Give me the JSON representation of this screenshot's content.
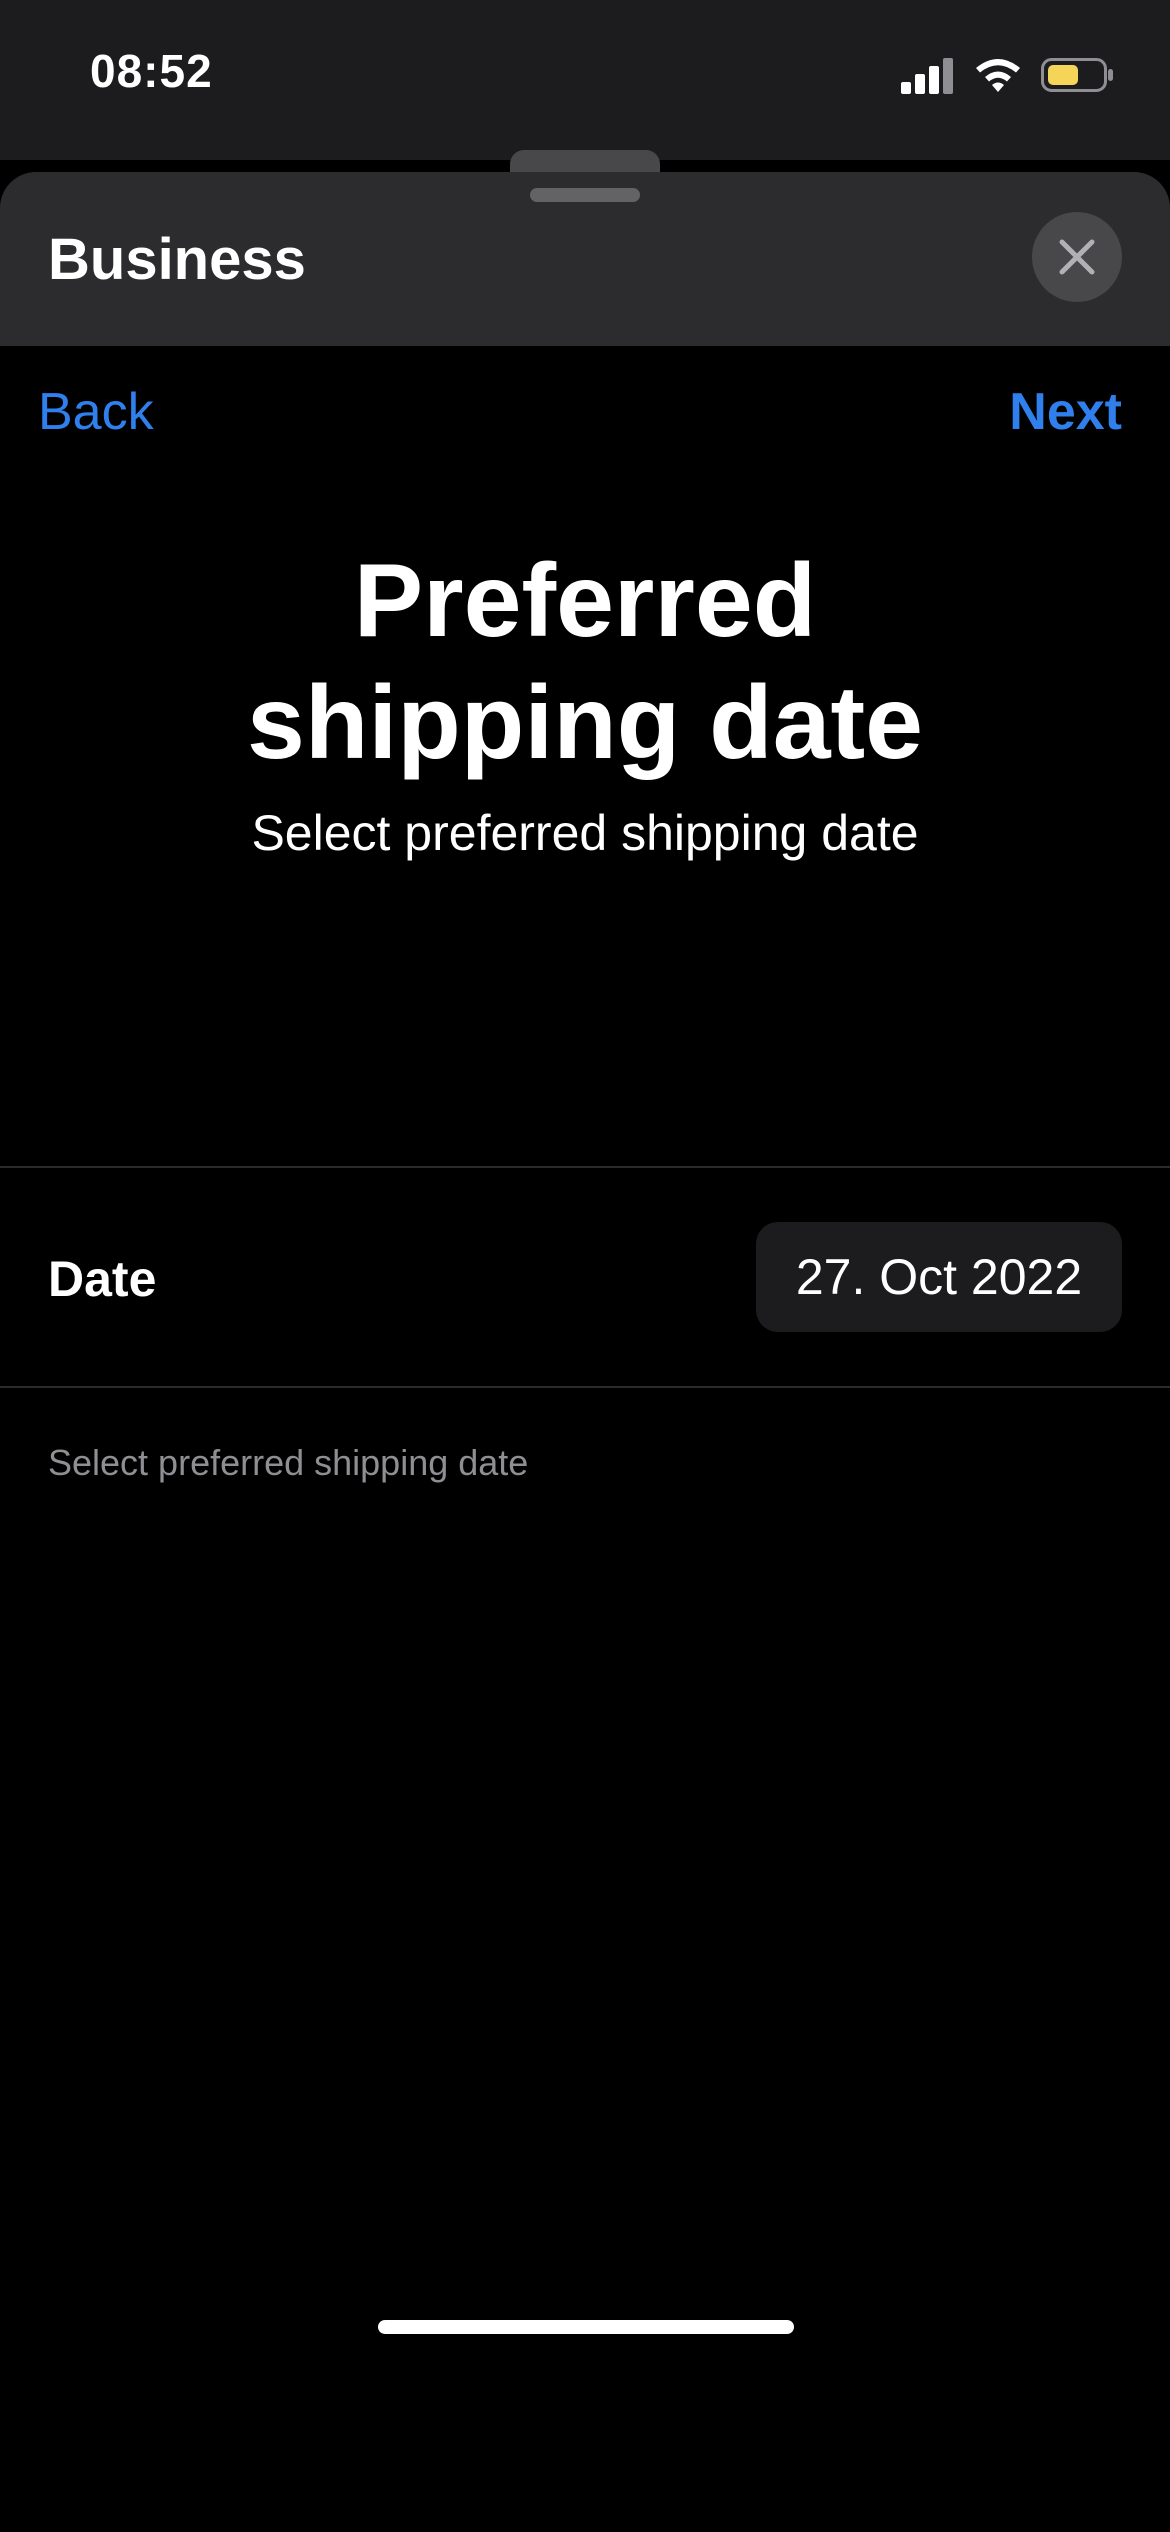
{
  "status_bar": {
    "time": "08:52",
    "icons": [
      "cellular-signal-icon",
      "wifi-icon",
      "battery-icon"
    ],
    "battery_color": "#f4d55a"
  },
  "sheet": {
    "title": "Business",
    "close_icon": "close-icon"
  },
  "nav": {
    "back_label": "Back",
    "next_label": "Next",
    "accent_color": "#2f80ed"
  },
  "page": {
    "title_line1": "Preferred",
    "title_line2": "shipping date",
    "subtitle": "Select preferred shipping date"
  },
  "form": {
    "date_label": "Date",
    "date_value": "27. Oct 2022",
    "footer_note": "Select preferred shipping date"
  }
}
